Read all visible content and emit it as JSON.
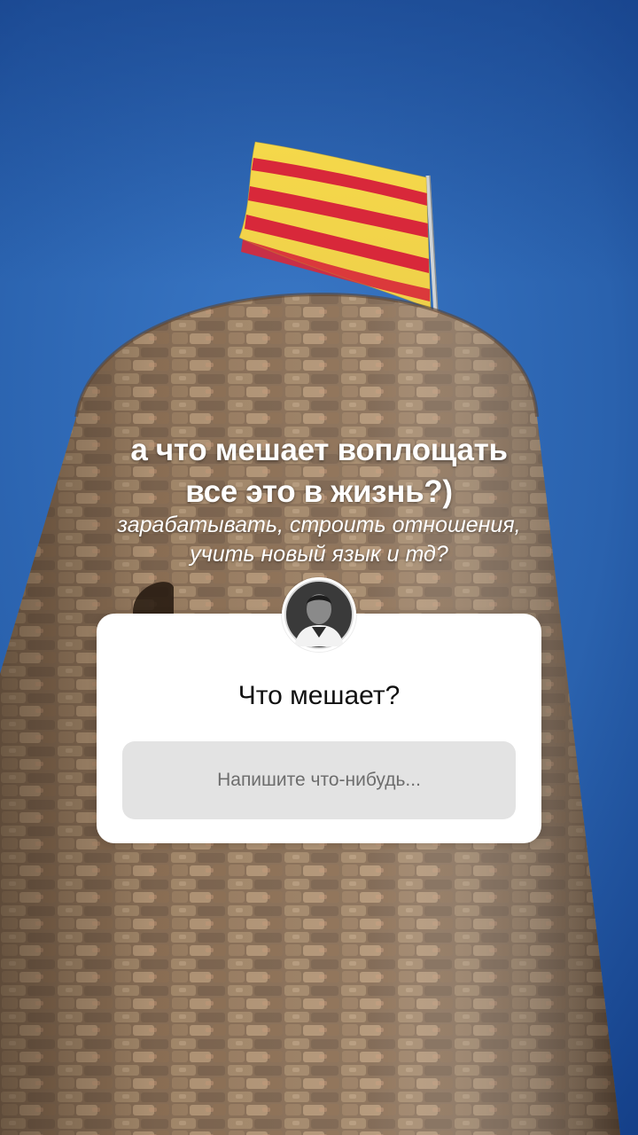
{
  "story": {
    "headline_line1": "а что мешает воплощать",
    "headline_line2": "все это в жизнь?)",
    "subline_line1": "зарабатывать, строить отношения,",
    "subline_line2": "учить новый язык и тд?"
  },
  "question_sticker": {
    "title": "Что мешает?",
    "input_placeholder": "Напишите что-нибудь..."
  },
  "colors": {
    "sky_top": "#2d66b3",
    "sky_edge": "#123c86",
    "flag_yellow": "#f5d84a",
    "flag_red": "#d8283a",
    "stone": "#8b7259",
    "card_background": "#ffffff",
    "input_background": "#e3e3e3"
  },
  "icons": {
    "avatar": "profile-photo-avatar"
  }
}
